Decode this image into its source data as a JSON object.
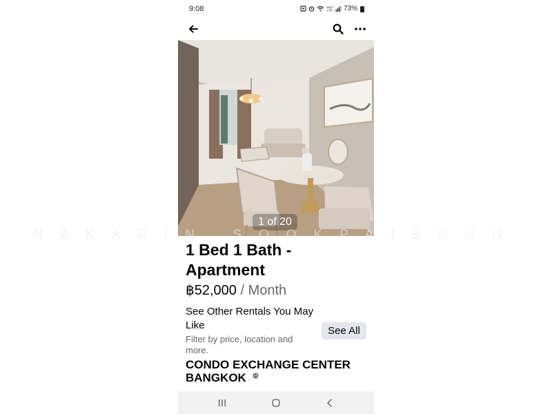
{
  "status_bar": {
    "time": "9:08",
    "battery": "73%",
    "icons": [
      "alarm-icon",
      "alarm-clock-icon",
      "wifi-icon",
      "lte-icon",
      "signal-icon",
      "battery-icon"
    ]
  },
  "top_bar": {
    "icons": [
      "arrow-left-icon",
      "search-icon",
      "more-horizontal-icon"
    ]
  },
  "photo": {
    "counter": "1 of 20"
  },
  "listing": {
    "title": "1 Bed 1 Bath - Apartment",
    "price": "฿52,000",
    "period": " / Month"
  },
  "suggestions": {
    "title": "See Other Rentals You May Like",
    "subtitle": "Filter by price, location and more.",
    "button": "See All"
  },
  "seller": {
    "name": "CONDO EXCHANGE CENTER BANGKOK",
    "meta": " · "
  },
  "nav_bar": {
    "icons": [
      "recent-apps-icon",
      "home-icon",
      "back-icon"
    ]
  },
  "watermark": "NAKARIN SOOKPAIBOON",
  "colors": {
    "text": "#050505",
    "secondary": "#65676b",
    "button_bg": "#e4e6eb",
    "nav_bg": "#f2f2f2"
  }
}
